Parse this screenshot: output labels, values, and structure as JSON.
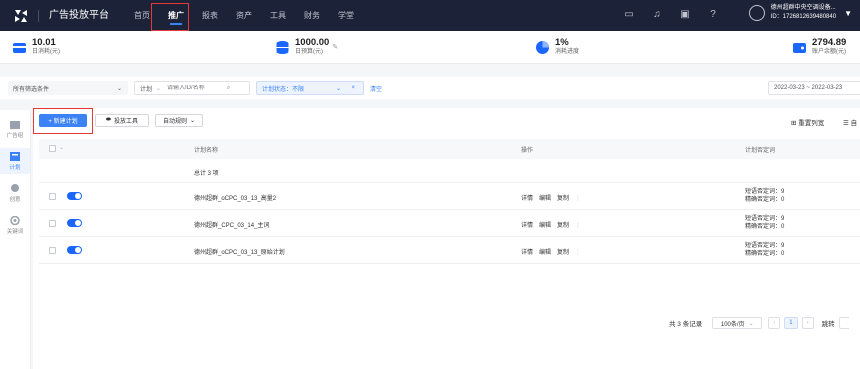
{
  "header": {
    "brand": "广告投放平台",
    "nav": [
      "首页",
      "推广",
      "报表",
      "资产",
      "工具",
      "财务",
      "学堂"
    ],
    "active_nav": "推广",
    "user_name": "德州超群中央空调设备...",
    "user_id": "ID：1726812639480840"
  },
  "stats": [
    {
      "value": "10.01",
      "label": "日消耗(元)",
      "icon": "wallet-icon"
    },
    {
      "value": "1000.00",
      "label": "日预算(元)",
      "icon": "database-icon"
    },
    {
      "value": "1%",
      "label": "消耗进度",
      "icon": "pie-icon"
    },
    {
      "value": "2794.89",
      "label": "账户余额(元)",
      "icon": "card-icon"
    }
  ],
  "filter": {
    "all_filters": "所有筛选条件",
    "scope": "计划",
    "search_placeholder": "请输入ID/名称",
    "status_tag": "计划状态：不限",
    "clear": "清空",
    "date_range": "2022-03-23  ~  2022-03-23"
  },
  "sidebar": [
    "广告组",
    "计划",
    "创意",
    "关键词"
  ],
  "toolbar": {
    "new_plan": "+ 新建计划",
    "delivery_tool": "投放工具",
    "auto_rule": "自动规则",
    "reset_columns": "重置列宽",
    "custom": "自"
  },
  "table": {
    "headers": [
      "计划名称",
      "操作",
      "计划否定词"
    ],
    "total": "总计 3 项",
    "rows": [
      {
        "name": "德州超群_oCPC_03_13_高量2",
        "ops": [
          "详情",
          "编辑",
          "复制"
        ],
        "neg1": "短语否定词：9",
        "neg2": "精确否定词：0"
      },
      {
        "name": "德州超群_CPC_03_14_主词",
        "ops": [
          "详情",
          "编辑",
          "复制"
        ],
        "neg1": "短语否定词：9",
        "neg2": "精确否定词：0"
      },
      {
        "name": "德州超群_oCPC_03_13_原始计划",
        "ops": [
          "详情",
          "编辑",
          "复制"
        ],
        "neg1": "短语否定词：9",
        "neg2": "精确否定词：0"
      }
    ]
  },
  "pagination": {
    "total": "共 3 条记录",
    "page_size": "100条/页",
    "current": "1",
    "goto": "跳转"
  },
  "colors": {
    "accent": "#3b82f6",
    "topbar": "#1c2237"
  }
}
